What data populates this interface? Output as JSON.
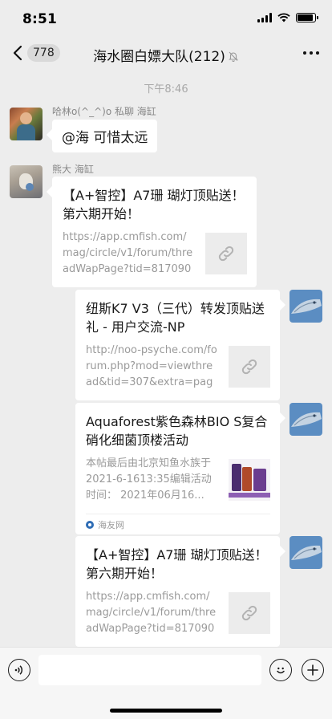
{
  "status_bar": {
    "time": "8:51",
    "battery_level": 0.92
  },
  "nav": {
    "back_count": "778",
    "title": "海水圈白嫖大队(212)"
  },
  "chat": {
    "timestamp": "下午8:46",
    "messages": [
      {
        "sender": "哈林o(^_^)o 私聊 海缸",
        "text": "@海 可惜太远"
      },
      {
        "sender": "熊大 海缸",
        "title": "【A+智控】A7珊 瑚灯顶贴送！第六期开始！",
        "desc": "https://app.cmfish.com/mag/circle/v1/forum/threadWapPage?tid=817090&..."
      },
      {
        "title": "纽斯K7 V3（三代）转发顶贴送礼 - 用户交流-NP",
        "desc": "http://noo-psyche.com/forum.php?mod=viewthread&tid=307&extra=page..."
      },
      {
        "title": "Aquaforest紫色森林BIO S复合硝化细菌顶楼活动",
        "desc": "本帖最后由北京知鱼水族于2021-6-1613:35编辑活动时间： 2021年06月16...",
        "source": "海友网"
      },
      {
        "title": "【A+智控】A7珊 瑚灯顶贴送！第六期开始！",
        "desc": "https://app.cmfish.com/mag/circle/v1/forum/threadWapPage?tid=817090&..."
      }
    ]
  },
  "icons": {
    "back": "chevron-left-icon",
    "mute": "bell-off-icon",
    "more": "more-dots-icon",
    "link": "link-icon",
    "voice": "voice-icon",
    "emoji": "emoji-icon",
    "plus": "plus-icon"
  }
}
